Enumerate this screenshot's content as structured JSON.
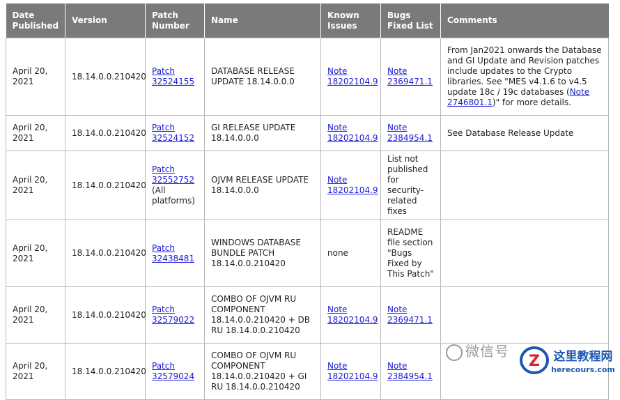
{
  "headers": [
    "Date Published",
    "Version",
    "Patch Number",
    "Name",
    "Known Issues",
    "Bugs Fixed List",
    "Comments"
  ],
  "rows": [
    {
      "date": "April 20, 2021",
      "version": "18.14.0.0.210420",
      "patch_link": "Patch 32524155",
      "patch_extra": "",
      "name": "DATABASE RELEASE UPDATE 18.14.0.0.0",
      "known_issues": "Note 18202104.9",
      "bugs_fixed": "Note 2369471.1",
      "comments_pre": "From Jan2021 onwards the Database and GI Update and Revision patches include updates to the Crypto libraries. See \"MES v4.1.6 to v4.5 update 18c / 19c databases (",
      "comments_link": "Note 2746801.1",
      "comments_post": ")\" for more details."
    },
    {
      "date": "April 20, 2021",
      "version": "18.14.0.0.210420",
      "patch_link": "Patch 32524152",
      "patch_extra": "",
      "name": "GI RELEASE UPDATE 18.14.0.0.0",
      "known_issues": "Note 18202104.9",
      "bugs_fixed": "Note 2384954.1",
      "comments_pre": "See Database Release Update",
      "comments_link": "",
      "comments_post": ""
    },
    {
      "date": "April 20, 2021",
      "version": "18.14.0.0.210420",
      "patch_link": "Patch 32552752",
      "patch_extra": "(All platforms)",
      "name": "OJVM RELEASE UPDATE 18.14.0.0.0",
      "known_issues": "Note 18202104.9",
      "bugs_fixed_text": "List not published for security-related fixes",
      "comments_pre": "",
      "comments_link": "",
      "comments_post": ""
    },
    {
      "date": "April 20, 2021",
      "version": "18.14.0.0.210420",
      "patch_link": "Patch 32438481",
      "patch_extra": "",
      "name": "WINDOWS DATABASE BUNDLE PATCH 18.14.0.0.210420",
      "known_issues_text": "none",
      "bugs_fixed_text": "README file section \"Bugs Fixed by This Patch\"",
      "comments_pre": "",
      "comments_link": "",
      "comments_post": ""
    },
    {
      "date": "April 20, 2021",
      "version": "18.14.0.0.210420",
      "patch_link": "Patch 32579022",
      "patch_extra": "",
      "name": "COMBO OF OJVM RU COMPONENT 18.14.0.0.210420 + DB RU 18.14.0.0.210420",
      "known_issues": "Note 18202104.9",
      "bugs_fixed": "Note 2369471.1",
      "comments_pre": "",
      "comments_link": "",
      "comments_post": ""
    },
    {
      "date": "April 20, 2021",
      "version": "18.14.0.0.210420",
      "patch_link": "Patch 32579024",
      "patch_extra": "",
      "name": "COMBO OF OJVM RU COMPONENT 18.14.0.0.210420 + GI RU 18.14.0.0.210420",
      "known_issues": "Note 18202104.9",
      "bugs_fixed": "Note 2384954.1",
      "comments_pre": "",
      "comments_link": "",
      "comments_post": ""
    }
  ],
  "watermark": "微信号",
  "logo": {
    "title": "这里教程网",
    "url_text": "herecours.com"
  }
}
